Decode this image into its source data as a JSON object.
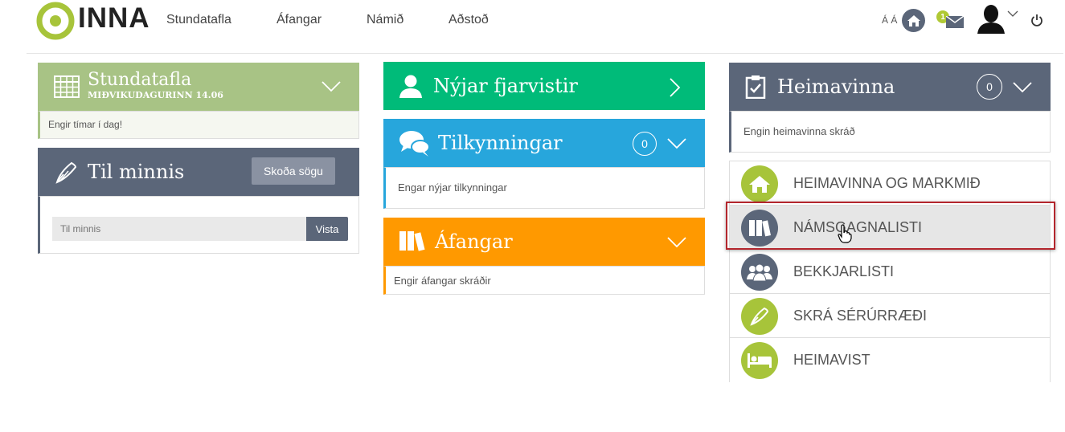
{
  "header": {
    "logo_text": "INNA",
    "nav": [
      "Stundatafla",
      "Áfangar",
      "Námið",
      "Aðstoð"
    ],
    "accessibility_label": "Á Á",
    "mail_count": "1",
    "colors": {
      "logo_green": "#a7c43a",
      "nav_text": "#444444"
    }
  },
  "stundatafla": {
    "title": "Stundatafla",
    "subtitle": "MIÐVIKUDAGURINN 14.06",
    "body": "Engir tímar í dag!",
    "color": "#a8c385"
  },
  "til_minnis": {
    "title": "Til minnis",
    "history_button": "Skoða sögu",
    "input_placeholder": "Til minnis",
    "save_button": "Vista",
    "color": "#5b6679"
  },
  "fjarvistir": {
    "title": "Nýjar fjarvistir",
    "color": "#00bb79"
  },
  "tilkynningar": {
    "title": "Tilkynningar",
    "count": "0",
    "body": "Engar nýjar tilkynningar",
    "color": "#27a6dc"
  },
  "afangar": {
    "title": "Áfangar",
    "body": "Engir áfangar skráðir",
    "color": "#ff9900"
  },
  "heimavinna": {
    "title": "Heimavinna",
    "count": "0",
    "body": "Engin heimavinna skráð",
    "color": "#5b6679"
  },
  "links": [
    {
      "label": "HEIMAVINNA OG MARKMIÐ",
      "icon": "home-icon",
      "color": "#a7c43a"
    },
    {
      "label": "NÁMSGAGNALISTI",
      "icon": "books-icon",
      "color": "#5b6679",
      "active": true
    },
    {
      "label": "BEKKJARLISTI",
      "icon": "group-icon",
      "color": "#5b6679"
    },
    {
      "label": "SKRÁ SÉRÚRRÆÐI",
      "icon": "pen-icon",
      "color": "#a7c43a"
    },
    {
      "label": "HEIMAVIST",
      "icon": "bed-icon",
      "color": "#a7c43a"
    }
  ]
}
